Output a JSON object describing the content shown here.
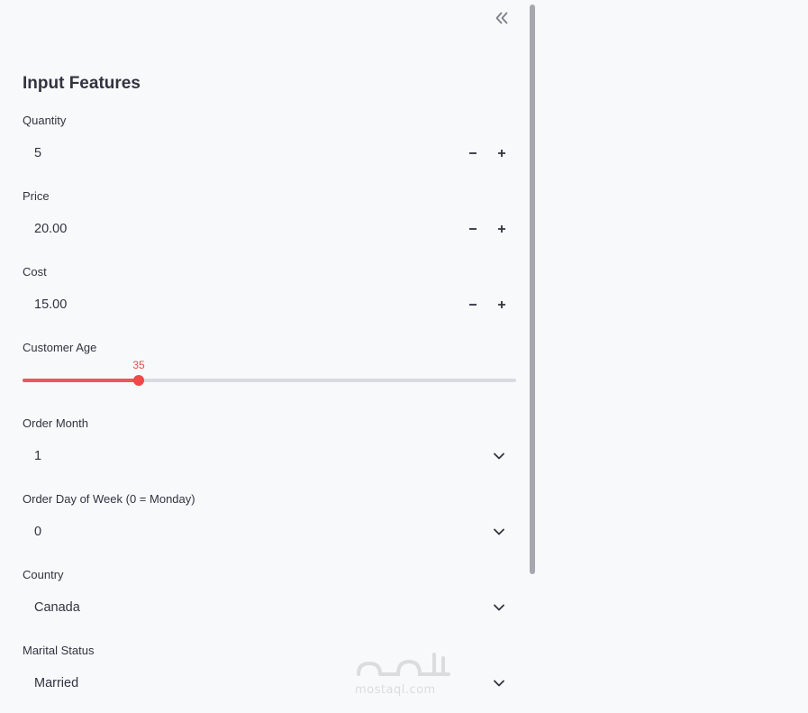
{
  "sidebar": {
    "collapse_icon": "double-chevron-left-icon",
    "title": "Input Features",
    "quantity": {
      "label": "Quantity",
      "value": "5"
    },
    "price": {
      "label": "Price",
      "value": "20.00"
    },
    "cost": {
      "label": "Cost",
      "value": "15.00"
    },
    "customer_age": {
      "label": "Customer Age",
      "value": "35",
      "min": 0,
      "max": 150,
      "fraction": 0.235
    },
    "order_month": {
      "label": "Order Month",
      "value": "1"
    },
    "order_day": {
      "label": "Order Day of Week (0 = Monday)",
      "value": "0"
    },
    "country": {
      "label": "Country",
      "value": "Canada"
    },
    "marital_status": {
      "label": "Marital Status",
      "value": "Married"
    }
  },
  "colors": {
    "accent": "#f04848",
    "background": "#f8f9fb",
    "text": "#31333f"
  },
  "watermark": {
    "text": "mostaql.com"
  }
}
